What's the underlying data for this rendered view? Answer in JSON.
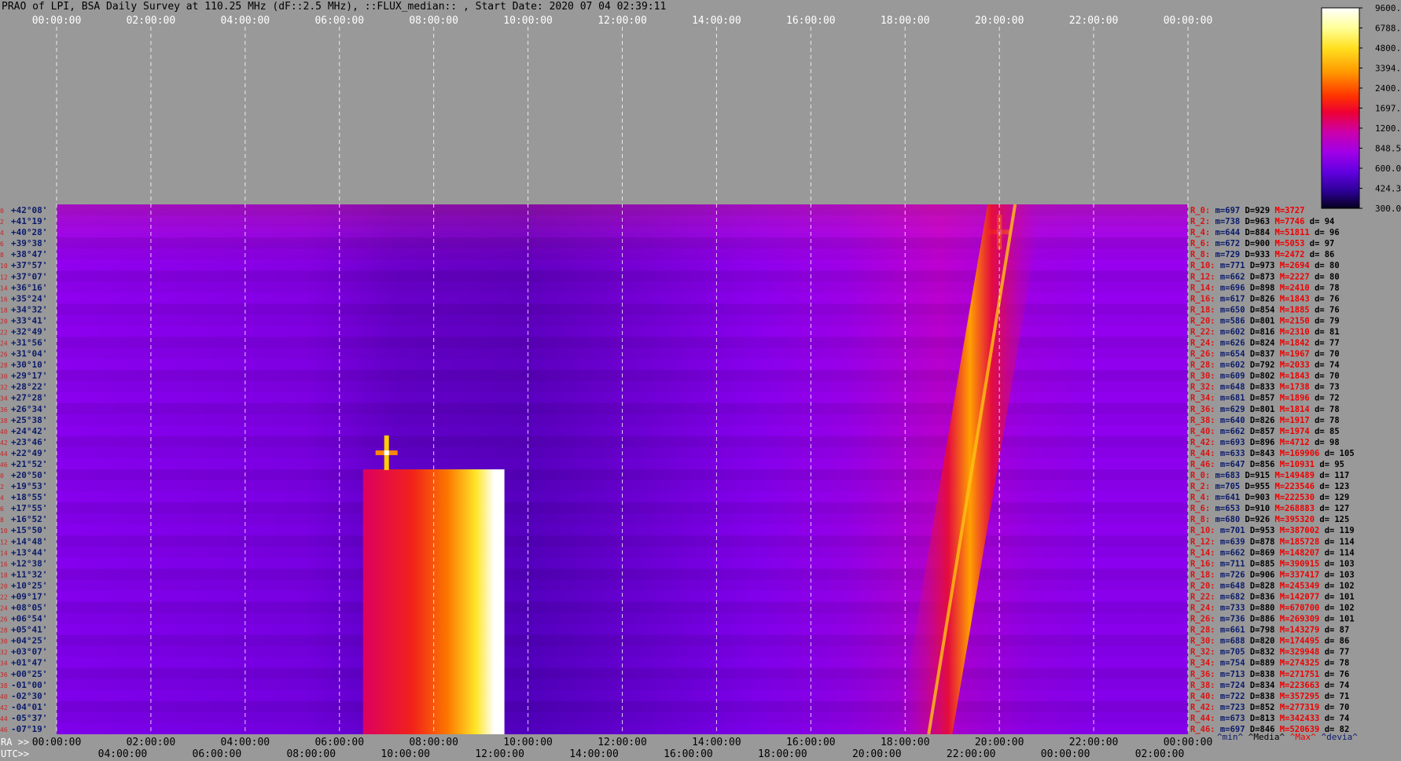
{
  "title": "PRAO of LPI, BSA Daily Survey at 110.25 MHz (dF::2.5 MHz), ::FLUX_median:: , Start Date: 2020 07 04 02:39:11",
  "colors": {
    "background": "#999999",
    "axis_text_top": "#ffffff",
    "grid": "#ffffff",
    "row_index": "#cc2222",
    "dec_label": "#0a1a6a",
    "stat_name": "#dd1111",
    "stat_min": "#0a1a6a",
    "stat_median": "#000000",
    "stat_max": "#ee0000",
    "stat_dev": "#000000"
  },
  "chart_data": {
    "type": "heatmap",
    "x_axis_top": {
      "label": "",
      "ticks": [
        "00:00:00",
        "02:00:00",
        "04:00:00",
        "06:00:00",
        "08:00:00",
        "10:00:00",
        "12:00:00",
        "14:00:00",
        "16:00:00",
        "18:00:00",
        "20:00:00",
        "22:00:00",
        "00:00:00"
      ]
    },
    "x_axis_ra": {
      "label": "RA >>",
      "ticks": [
        "00:00:00",
        "02:00:00",
        "04:00:00",
        "06:00:00",
        "08:00:00",
        "10:00:00",
        "12:00:00",
        "14:00:00",
        "16:00:00",
        "18:00:00",
        "20:00:00",
        "22:00:00",
        "00:00:00"
      ]
    },
    "x_axis_utc": {
      "label": "UTC>>",
      "ticks": [
        "04:00:00",
        "06:00:00",
        "08:00:00",
        "10:00:00",
        "12:00:00",
        "14:00:00",
        "16:00:00",
        "18:00:00",
        "20:00:00",
        "22:00:00",
        "00:00:00",
        "02:00:00"
      ]
    },
    "colorbar": {
      "ticks": [
        "9600.0",
        "6788.2",
        "4800.0",
        "3394.1",
        "2400.0",
        "1697.1",
        "1200.0",
        "848.5",
        "600.0",
        "424.3",
        "300.0"
      ],
      "range": [
        300,
        9600
      ],
      "scale": "log"
    },
    "rows": [
      {
        "i": "0",
        "dec": "+42°08'"
      },
      {
        "i": "2",
        "dec": "+41°19'"
      },
      {
        "i": "4",
        "dec": "+40°28'"
      },
      {
        "i": "6",
        "dec": "+39°38'"
      },
      {
        "i": "8",
        "dec": "+38°47'"
      },
      {
        "i": "10",
        "dec": "+37°57'"
      },
      {
        "i": "12",
        "dec": "+37°07'"
      },
      {
        "i": "14",
        "dec": "+36°16'"
      },
      {
        "i": "16",
        "dec": "+35°24'"
      },
      {
        "i": "18",
        "dec": "+34°32'"
      },
      {
        "i": "20",
        "dec": "+33°41'"
      },
      {
        "i": "22",
        "dec": "+32°49'"
      },
      {
        "i": "24",
        "dec": "+31°56'"
      },
      {
        "i": "26",
        "dec": "+31°04'"
      },
      {
        "i": "28",
        "dec": "+30°10'"
      },
      {
        "i": "30",
        "dec": "+29°17'"
      },
      {
        "i": "32",
        "dec": "+28°22'"
      },
      {
        "i": "34",
        "dec": "+27°28'"
      },
      {
        "i": "36",
        "dec": "+26°34'"
      },
      {
        "i": "38",
        "dec": "+25°38'"
      },
      {
        "i": "40",
        "dec": "+24°42'"
      },
      {
        "i": "42",
        "dec": "+23°46'"
      },
      {
        "i": "44",
        "dec": "+22°49'"
      },
      {
        "i": "46",
        "dec": "+21°52'"
      },
      {
        "i": "0",
        "dec": "+20°50'"
      },
      {
        "i": "2",
        "dec": "+19°53'"
      },
      {
        "i": "4",
        "dec": "+18°55'"
      },
      {
        "i": "6",
        "dec": "+17°55'"
      },
      {
        "i": "8",
        "dec": "+16°52'"
      },
      {
        "i": "10",
        "dec": "+15°50'"
      },
      {
        "i": "12",
        "dec": "+14°48'"
      },
      {
        "i": "14",
        "dec": "+13°44'"
      },
      {
        "i": "16",
        "dec": "+12°38'"
      },
      {
        "i": "18",
        "dec": "+11°32'"
      },
      {
        "i": "20",
        "dec": "+10°25'"
      },
      {
        "i": "22",
        "dec": "+09°17'"
      },
      {
        "i": "24",
        "dec": "+08°05'"
      },
      {
        "i": "26",
        "dec": "+06°54'"
      },
      {
        "i": "28",
        "dec": "+05°41'"
      },
      {
        "i": "30",
        "dec": "+04°25'"
      },
      {
        "i": "32",
        "dec": "+03°07'"
      },
      {
        "i": "34",
        "dec": "+01°47'"
      },
      {
        "i": "36",
        "dec": "+00°25'"
      },
      {
        "i": "38",
        "dec": "-01°00'"
      },
      {
        "i": "40",
        "dec": "-02°30'"
      },
      {
        "i": "42",
        "dec": "-04°01'"
      },
      {
        "i": "44",
        "dec": "-05°37'"
      },
      {
        "i": "46",
        "dec": "-07°19'"
      }
    ],
    "stats": [
      {
        "name": "R_0:",
        "m": "m=697",
        "D": "D=929",
        "M": "M=3727",
        "d": ""
      },
      {
        "name": "R_2:",
        "m": "m=738",
        "D": "D=963",
        "M": "M=7746",
        "d": "d= 94"
      },
      {
        "name": "R_4:",
        "m": "m=644",
        "D": "D=884",
        "M": "M=51811",
        "d": "d= 96"
      },
      {
        "name": "R_6:",
        "m": "m=672",
        "D": "D=900",
        "M": "M=5053",
        "d": "d= 97"
      },
      {
        "name": "R_8:",
        "m": "m=729",
        "D": "D=933",
        "M": "M=2472",
        "d": "d= 86"
      },
      {
        "name": "R_10:",
        "m": "m=771",
        "D": "D=973",
        "M": "M=2694",
        "d": "d= 80"
      },
      {
        "name": "R_12:",
        "m": "m=662",
        "D": "D=873",
        "M": "M=2227",
        "d": "d= 80"
      },
      {
        "name": "R_14:",
        "m": "m=696",
        "D": "D=898",
        "M": "M=2410",
        "d": "d= 78"
      },
      {
        "name": "R_16:",
        "m": "m=617",
        "D": "D=826",
        "M": "M=1843",
        "d": "d= 76"
      },
      {
        "name": "R_18:",
        "m": "m=650",
        "D": "D=854",
        "M": "M=1885",
        "d": "d= 76"
      },
      {
        "name": "R_20:",
        "m": "m=586",
        "D": "D=801",
        "M": "M=2150",
        "d": "d= 79"
      },
      {
        "name": "R_22:",
        "m": "m=602",
        "D": "D=816",
        "M": "M=2310",
        "d": "d= 81"
      },
      {
        "name": "R_24:",
        "m": "m=626",
        "D": "D=824",
        "M": "M=1842",
        "d": "d= 77"
      },
      {
        "name": "R_26:",
        "m": "m=654",
        "D": "D=837",
        "M": "M=1967",
        "d": "d= 70"
      },
      {
        "name": "R_28:",
        "m": "m=602",
        "D": "D=792",
        "M": "M=2033",
        "d": "d= 74"
      },
      {
        "name": "R_30:",
        "m": "m=609",
        "D": "D=802",
        "M": "M=1843",
        "d": "d= 70"
      },
      {
        "name": "R_32:",
        "m": "m=648",
        "D": "D=833",
        "M": "M=1738",
        "d": "d= 73"
      },
      {
        "name": "R_34:",
        "m": "m=681",
        "D": "D=857",
        "M": "M=1896",
        "d": "d= 72"
      },
      {
        "name": "R_36:",
        "m": "m=629",
        "D": "D=801",
        "M": "M=1814",
        "d": "d= 78"
      },
      {
        "name": "R_38:",
        "m": "m=640",
        "D": "D=826",
        "M": "M=1917",
        "d": "d= 78"
      },
      {
        "name": "R_40:",
        "m": "m=662",
        "D": "D=857",
        "M": "M=1974",
        "d": "d= 85"
      },
      {
        "name": "R_42:",
        "m": "m=693",
        "D": "D=896",
        "M": "M=4712",
        "d": "d= 98"
      },
      {
        "name": "R_44:",
        "m": "m=633",
        "D": "D=843",
        "M": "M=169906",
        "d": "d= 105"
      },
      {
        "name": "R_46:",
        "m": "m=647",
        "D": "D=856",
        "M": "M=10931",
        "d": "d= 95"
      },
      {
        "name": "R_0:",
        "m": "m=683",
        "D": "D=915",
        "M": "M=149489",
        "d": "d= 117"
      },
      {
        "name": "R_2:",
        "m": "m=705",
        "D": "D=955",
        "M": "M=223546",
        "d": "d= 123"
      },
      {
        "name": "R_4:",
        "m": "m=641",
        "D": "D=903",
        "M": "M=222530",
        "d": "d= 129"
      },
      {
        "name": "R_6:",
        "m": "m=653",
        "D": "D=910",
        "M": "M=268883",
        "d": "d= 127"
      },
      {
        "name": "R_8:",
        "m": "m=680",
        "D": "D=926",
        "M": "M=395320",
        "d": "d= 125"
      },
      {
        "name": "R_10:",
        "m": "m=701",
        "D": "D=953",
        "M": "M=387002",
        "d": "d= 119"
      },
      {
        "name": "R_12:",
        "m": "m=639",
        "D": "D=878",
        "M": "M=185728",
        "d": "d= 114"
      },
      {
        "name": "R_14:",
        "m": "m=662",
        "D": "D=869",
        "M": "M=148207",
        "d": "d= 114"
      },
      {
        "name": "R_16:",
        "m": "m=711",
        "D": "D=885",
        "M": "M=390915",
        "d": "d= 103"
      },
      {
        "name": "R_18:",
        "m": "m=726",
        "D": "D=906",
        "M": "M=337417",
        "d": "d= 103"
      },
      {
        "name": "R_20:",
        "m": "m=648",
        "D": "D=828",
        "M": "M=245349",
        "d": "d= 102"
      },
      {
        "name": "R_22:",
        "m": "m=682",
        "D": "D=836",
        "M": "M=142077",
        "d": "d= 101"
      },
      {
        "name": "R_24:",
        "m": "m=733",
        "D": "D=880",
        "M": "M=670700",
        "d": "d= 102"
      },
      {
        "name": "R_26:",
        "m": "m=736",
        "D": "D=886",
        "M": "M=269309",
        "d": "d= 101"
      },
      {
        "name": "R_28:",
        "m": "m=661",
        "D": "D=798",
        "M": "M=143279",
        "d": "d= 87"
      },
      {
        "name": "R_30:",
        "m": "m=688",
        "D": "D=820",
        "M": "M=174495",
        "d": "d= 86"
      },
      {
        "name": "R_32:",
        "m": "m=705",
        "D": "D=832",
        "M": "M=329948",
        "d": "d= 77"
      },
      {
        "name": "R_34:",
        "m": "m=754",
        "D": "D=889",
        "M": "M=274325",
        "d": "d= 78"
      },
      {
        "name": "R_36:",
        "m": "m=713",
        "D": "D=838",
        "M": "M=271751",
        "d": "d= 76"
      },
      {
        "name": "R_38:",
        "m": "m=724",
        "D": "D=834",
        "M": "M=223663",
        "d": "d= 74"
      },
      {
        "name": "R_40:",
        "m": "m=722",
        "D": "D=838",
        "M": "M=357295",
        "d": "d= 71"
      },
      {
        "name": "R_42:",
        "m": "m=723",
        "D": "D=852",
        "M": "M=277319",
        "d": "d= 70"
      },
      {
        "name": "R_44:",
        "m": "m=673",
        "D": "D=813",
        "M": "M=342433",
        "d": "d= 74"
      },
      {
        "name": "R_46:",
        "m": "m=697",
        "D": "D=846",
        "M": "M=520639",
        "d": "d= 82"
      }
    ],
    "stats_footer": {
      "min": "^min^",
      "median": "^Media^",
      "max": "^Max^",
      "dev": "^devia^"
    },
    "features": [
      {
        "kind": "strong-source-block",
        "ra_start": "06:30:00",
        "ra_end": "09:30:00",
        "rows": "R_0..R_46 (second set)",
        "value": "≥9600"
      },
      {
        "kind": "point-source",
        "ra": "07:00:00",
        "dec": "+22°49'",
        "value": "≥9600"
      },
      {
        "kind": "point-source",
        "ra": "20:00:00",
        "dec": "+40°28'",
        "value": "≥9600"
      },
      {
        "kind": "galactic-plane-track",
        "ra_start_top": "20:15:00",
        "ra_end_bottom": "18:30:00",
        "value": "≈2400-6800"
      }
    ]
  }
}
